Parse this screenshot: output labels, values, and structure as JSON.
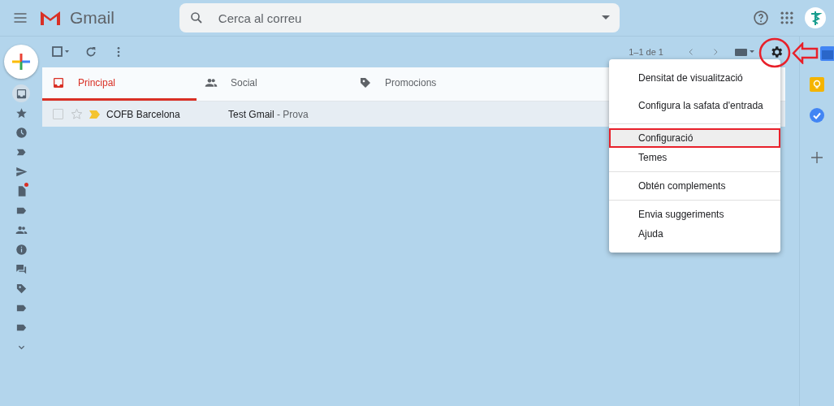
{
  "header": {
    "product": "Gmail",
    "search": {
      "placeholder": "Cerca al correu"
    }
  },
  "sidebar": {
    "items": [
      {
        "kind": "inbox",
        "selected": true,
        "notification": false
      },
      {
        "kind": "star",
        "selected": false,
        "notification": false
      },
      {
        "kind": "clock",
        "selected": false,
        "notification": false
      },
      {
        "kind": "important",
        "selected": false,
        "notification": false
      },
      {
        "kind": "send",
        "selected": false,
        "notification": false
      },
      {
        "kind": "draft",
        "selected": false,
        "notification": true
      },
      {
        "kind": "label",
        "selected": false,
        "notification": false
      },
      {
        "kind": "people",
        "selected": false,
        "notification": false
      },
      {
        "kind": "info",
        "selected": false,
        "notification": false
      },
      {
        "kind": "forum",
        "selected": false,
        "notification": false
      },
      {
        "kind": "tag",
        "selected": false,
        "notification": false
      },
      {
        "kind": "label",
        "selected": false,
        "notification": false
      },
      {
        "kind": "label",
        "selected": false,
        "notification": false
      },
      {
        "kind": "more",
        "selected": false,
        "notification": false
      }
    ]
  },
  "toolbar": {
    "select_all": {
      "checked": false
    },
    "pagination": "1–1 de 1"
  },
  "tabs": [
    {
      "label": "Principal",
      "kind": "inbox",
      "selected": true
    },
    {
      "label": "Social",
      "kind": "people",
      "selected": false
    },
    {
      "label": "Promocions",
      "kind": "tag",
      "selected": false
    }
  ],
  "messages": [
    {
      "checked": false,
      "starred": false,
      "important": true,
      "sender": "COFB Barcelona",
      "subject": "Test Gmail",
      "snippet": "- Prova"
    }
  ],
  "settings_menu": {
    "sections": [
      [
        {
          "label": "Densitat de visualització",
          "selected": false
        },
        {
          "label": "Configura la safata d'entrada",
          "selected": false
        }
      ],
      [
        {
          "label": "Configuració",
          "selected": true
        },
        {
          "label": "Temes",
          "selected": false
        }
      ],
      [
        {
          "label": "Obtén complements",
          "selected": false
        }
      ],
      [
        {
          "label": "Envia suggeriments",
          "selected": false
        },
        {
          "label": "Ajuda",
          "selected": false
        }
      ]
    ]
  }
}
